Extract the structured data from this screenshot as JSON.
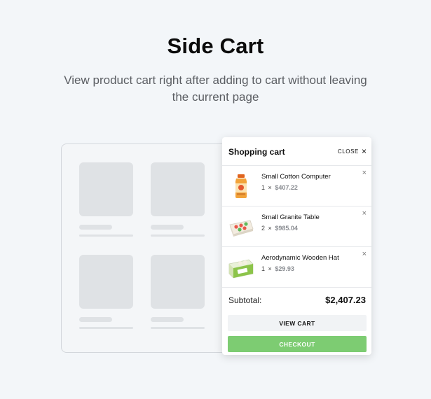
{
  "heading": {
    "title": "Side Cart",
    "subtitle": "View product cart right after adding to cart without leaving the current page"
  },
  "cart": {
    "title": "Shopping cart",
    "close_label": "CLOSE",
    "close_icon": "×",
    "items": [
      {
        "name": "Small Cotton Computer",
        "qty": "1",
        "price": "$407.22",
        "thumb_icon": "juice-bottle-icon"
      },
      {
        "name": "Small Granite Table",
        "qty": "2",
        "price": "$985.04",
        "thumb_icon": "egg-carton-icon"
      },
      {
        "name": "Aerodynamic Wooden Hat",
        "qty": "1",
        "price": "$29.93",
        "thumb_icon": "egg-box-icon"
      }
    ],
    "qty_separator": "×",
    "remove_icon": "×",
    "subtotal_label": "Subtotal:",
    "subtotal_value": "$2,407.23",
    "view_cart_label": "VIEW CART",
    "checkout_label": "CHECKOUT"
  },
  "colors": {
    "background": "#f3f6f9",
    "checkout": "#7dcc72",
    "placeholder": "#dfe2e5"
  }
}
